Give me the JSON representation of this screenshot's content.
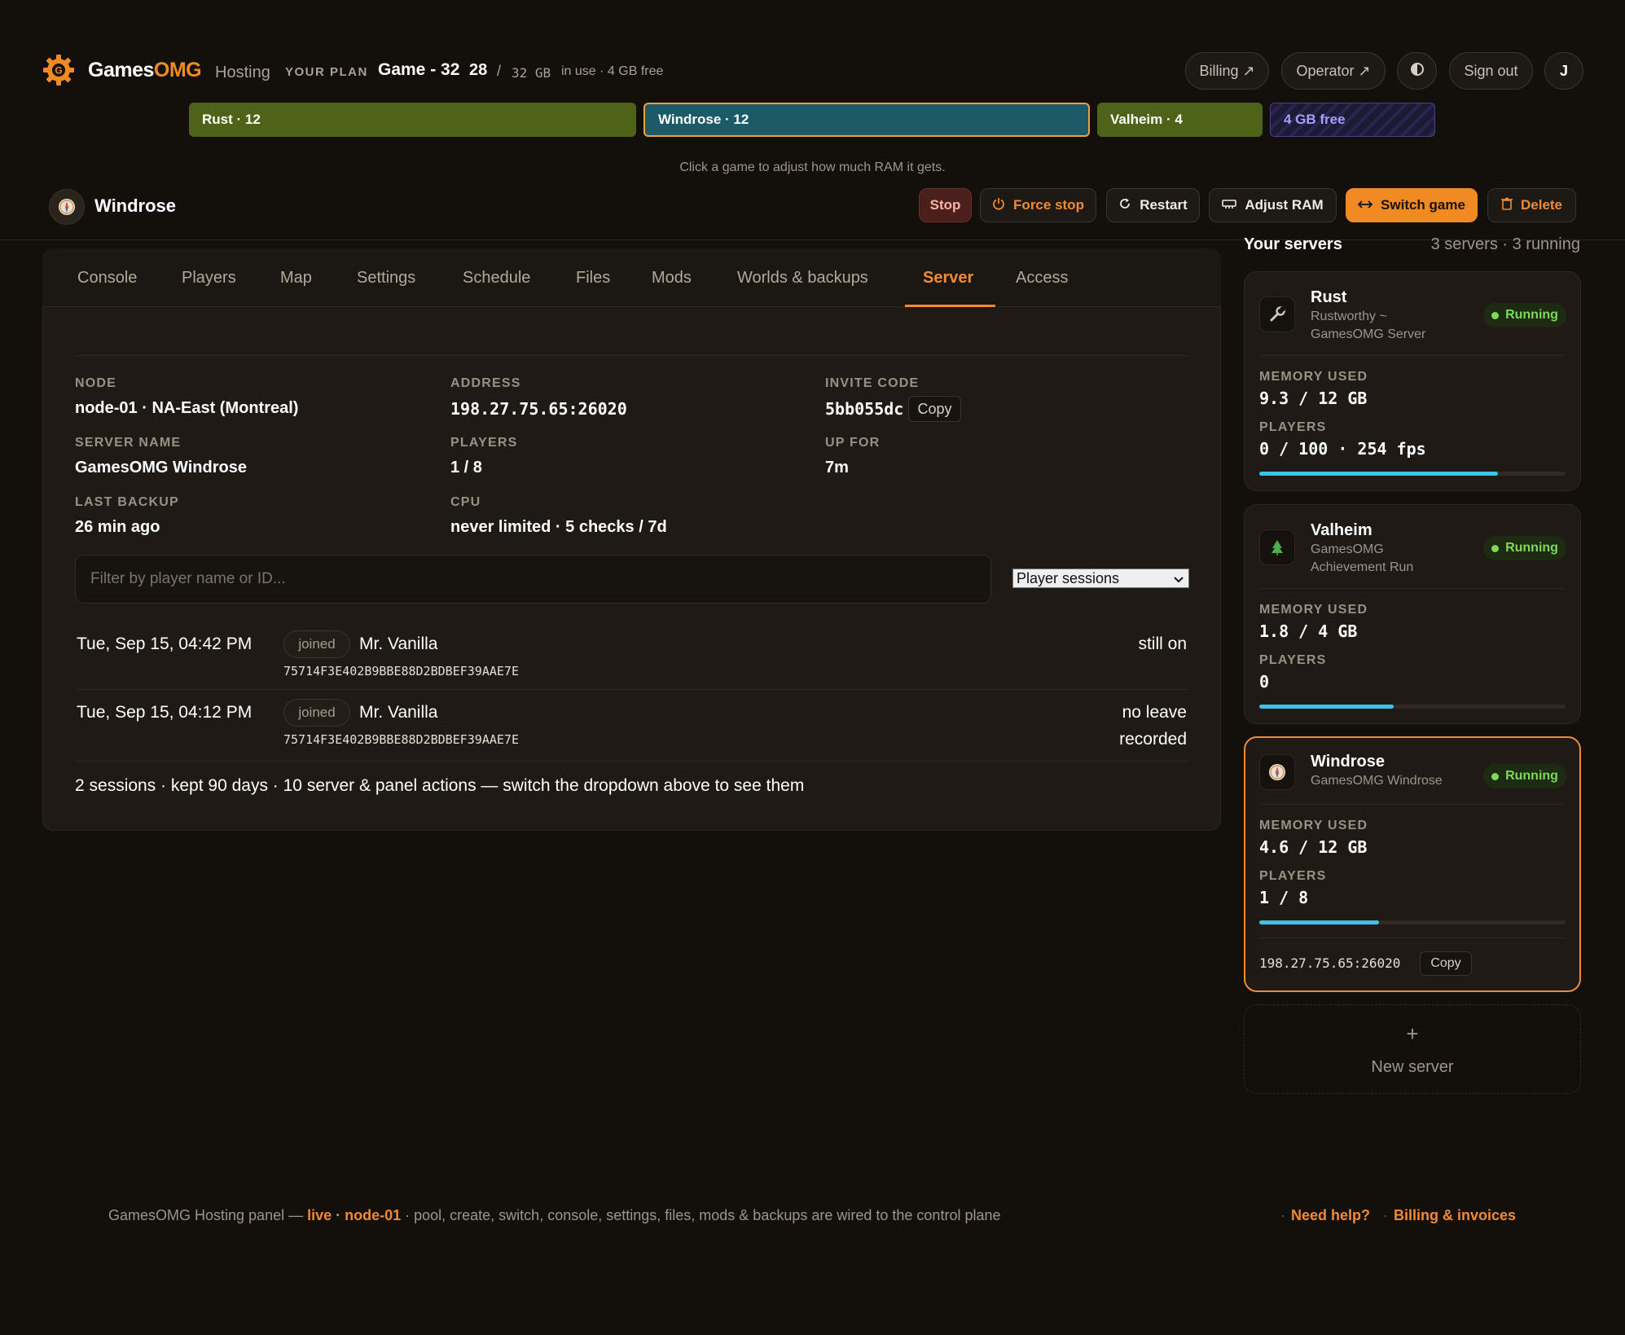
{
  "header": {
    "brand_prefix": "Games",
    "brand_suffix": "OMG",
    "brand_sub": "Hosting",
    "plan_label": "YOUR PLAN",
    "plan_name": "Game - 32",
    "plan_used": "28",
    "plan_slash": "/",
    "plan_total": "32 GB",
    "plan_info": "in use · 4 GB free",
    "billing": "Billing ↗",
    "operator": "Operator ↗",
    "signout": "Sign out",
    "avatar": "J"
  },
  "ram_pool": {
    "hint": "Click a game to adjust how much RAM it gets.",
    "segments": [
      {
        "label": "Rust · 12",
        "gb": 12,
        "color": "#4f6318"
      },
      {
        "label": "Windrose · 12",
        "gb": 12,
        "color": "#1b5a66"
      },
      {
        "label": "Valheim · 4",
        "gb": 4,
        "color": "#4f6318"
      },
      {
        "label": "4 GB free",
        "gb": 4,
        "color": "#7b6cf0"
      }
    ]
  },
  "server": {
    "title": "Windrose",
    "actions": {
      "stop": "Stop",
      "force_stop": "Force stop",
      "restart": "Restart",
      "adjust_ram": "Adjust RAM",
      "switch_game": "Switch game",
      "delete": "Delete"
    }
  },
  "tabs": [
    "Console",
    "Players",
    "Map",
    "Settings",
    "Schedule",
    "Files",
    "Mods",
    "Worlds & backups",
    "Server",
    "Access"
  ],
  "details": {
    "node_label": "NODE",
    "node": "node-01 · NA-East (Montreal)",
    "address_label": "ADDRESS",
    "address": "198.27.75.65:26020",
    "invite_label": "INVITE CODE",
    "invite": "5bb055dc",
    "copy": "Copy",
    "name_label": "SERVER NAME",
    "name": "GamesOMG Windrose",
    "players_label": "PLAYERS",
    "players": "1 / 8",
    "up_label": "UP FOR",
    "up": "7m",
    "backup_label": "LAST BACKUP",
    "backup": "26 min ago",
    "cpu_label": "CPU",
    "cpu": "never limited · 5 checks / 7d"
  },
  "filter": {
    "placeholder": "Filter by player name or ID...",
    "select_value": "Player sessions"
  },
  "sessions": [
    {
      "date": "Tue, Sep 15, 04:42 PM",
      "badge": "joined",
      "player": "Mr. Vanilla",
      "id": "75714F3E402B9BBE88D2BDBEF39AAE7E",
      "status1": "still on",
      "status2": ""
    },
    {
      "date": "Tue, Sep 15, 04:12 PM",
      "badge": "joined",
      "player": "Mr. Vanilla",
      "id": "75714F3E402B9BBE88D2BDBEF39AAE7E",
      "status1": "no leave",
      "status2": "recorded"
    }
  ],
  "summary": "2 sessions · kept 90 days · 10 server & panel actions — switch the dropdown above to see them",
  "sidebar": {
    "title": "Your servers",
    "count": "3 servers · 3 running",
    "memory_label": "MEMORY USED",
    "players_label": "PLAYERS",
    "status": "Running",
    "servers": [
      {
        "name": "Rust",
        "sub1": "Rustworthy ~",
        "sub2": "GamesOMG Server",
        "memory": "9.3 / 12 GB",
        "players": "0 / 100 · 254 fps",
        "fill": 0.78
      },
      {
        "name": "Valheim",
        "sub1": "GamesOMG",
        "sub2": "Achievement Run",
        "memory": "1.8 / 4 GB",
        "players": "0",
        "fill": 0.44
      },
      {
        "name": "Windrose",
        "sub1": "GamesOMG Windrose",
        "sub2": "",
        "memory": "4.6 / 12 GB",
        "players": "1 / 8",
        "fill": 0.39,
        "address": "198.27.75.65:26020",
        "copy": "Copy"
      }
    ],
    "new_plus": "+",
    "new_label": "New server"
  },
  "footer": {
    "prefix": "GamesOMG Hosting panel — ",
    "live": "live · node-01",
    "rest": " · pool, create, switch, console, settings, files, mods & backups are wired to the control plane",
    "help": "Need help?",
    "billing": "Billing & invoices"
  },
  "colors": {
    "accent": "#f28a35",
    "running": "#7ed957",
    "bar": "#3cc3e6"
  }
}
